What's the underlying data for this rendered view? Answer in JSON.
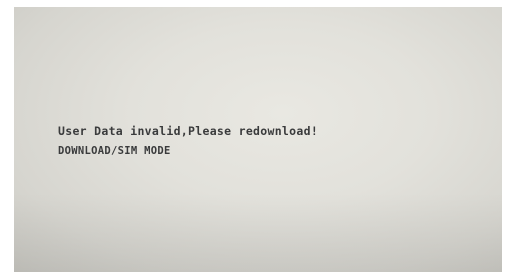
{
  "screen": {
    "error_message": "User Data invalid,Please redownload!",
    "mode_label": "DOWNLOAD/SIM MODE"
  },
  "colors": {
    "screen_background": "#e2e1db",
    "text": "#3a3b3c"
  }
}
